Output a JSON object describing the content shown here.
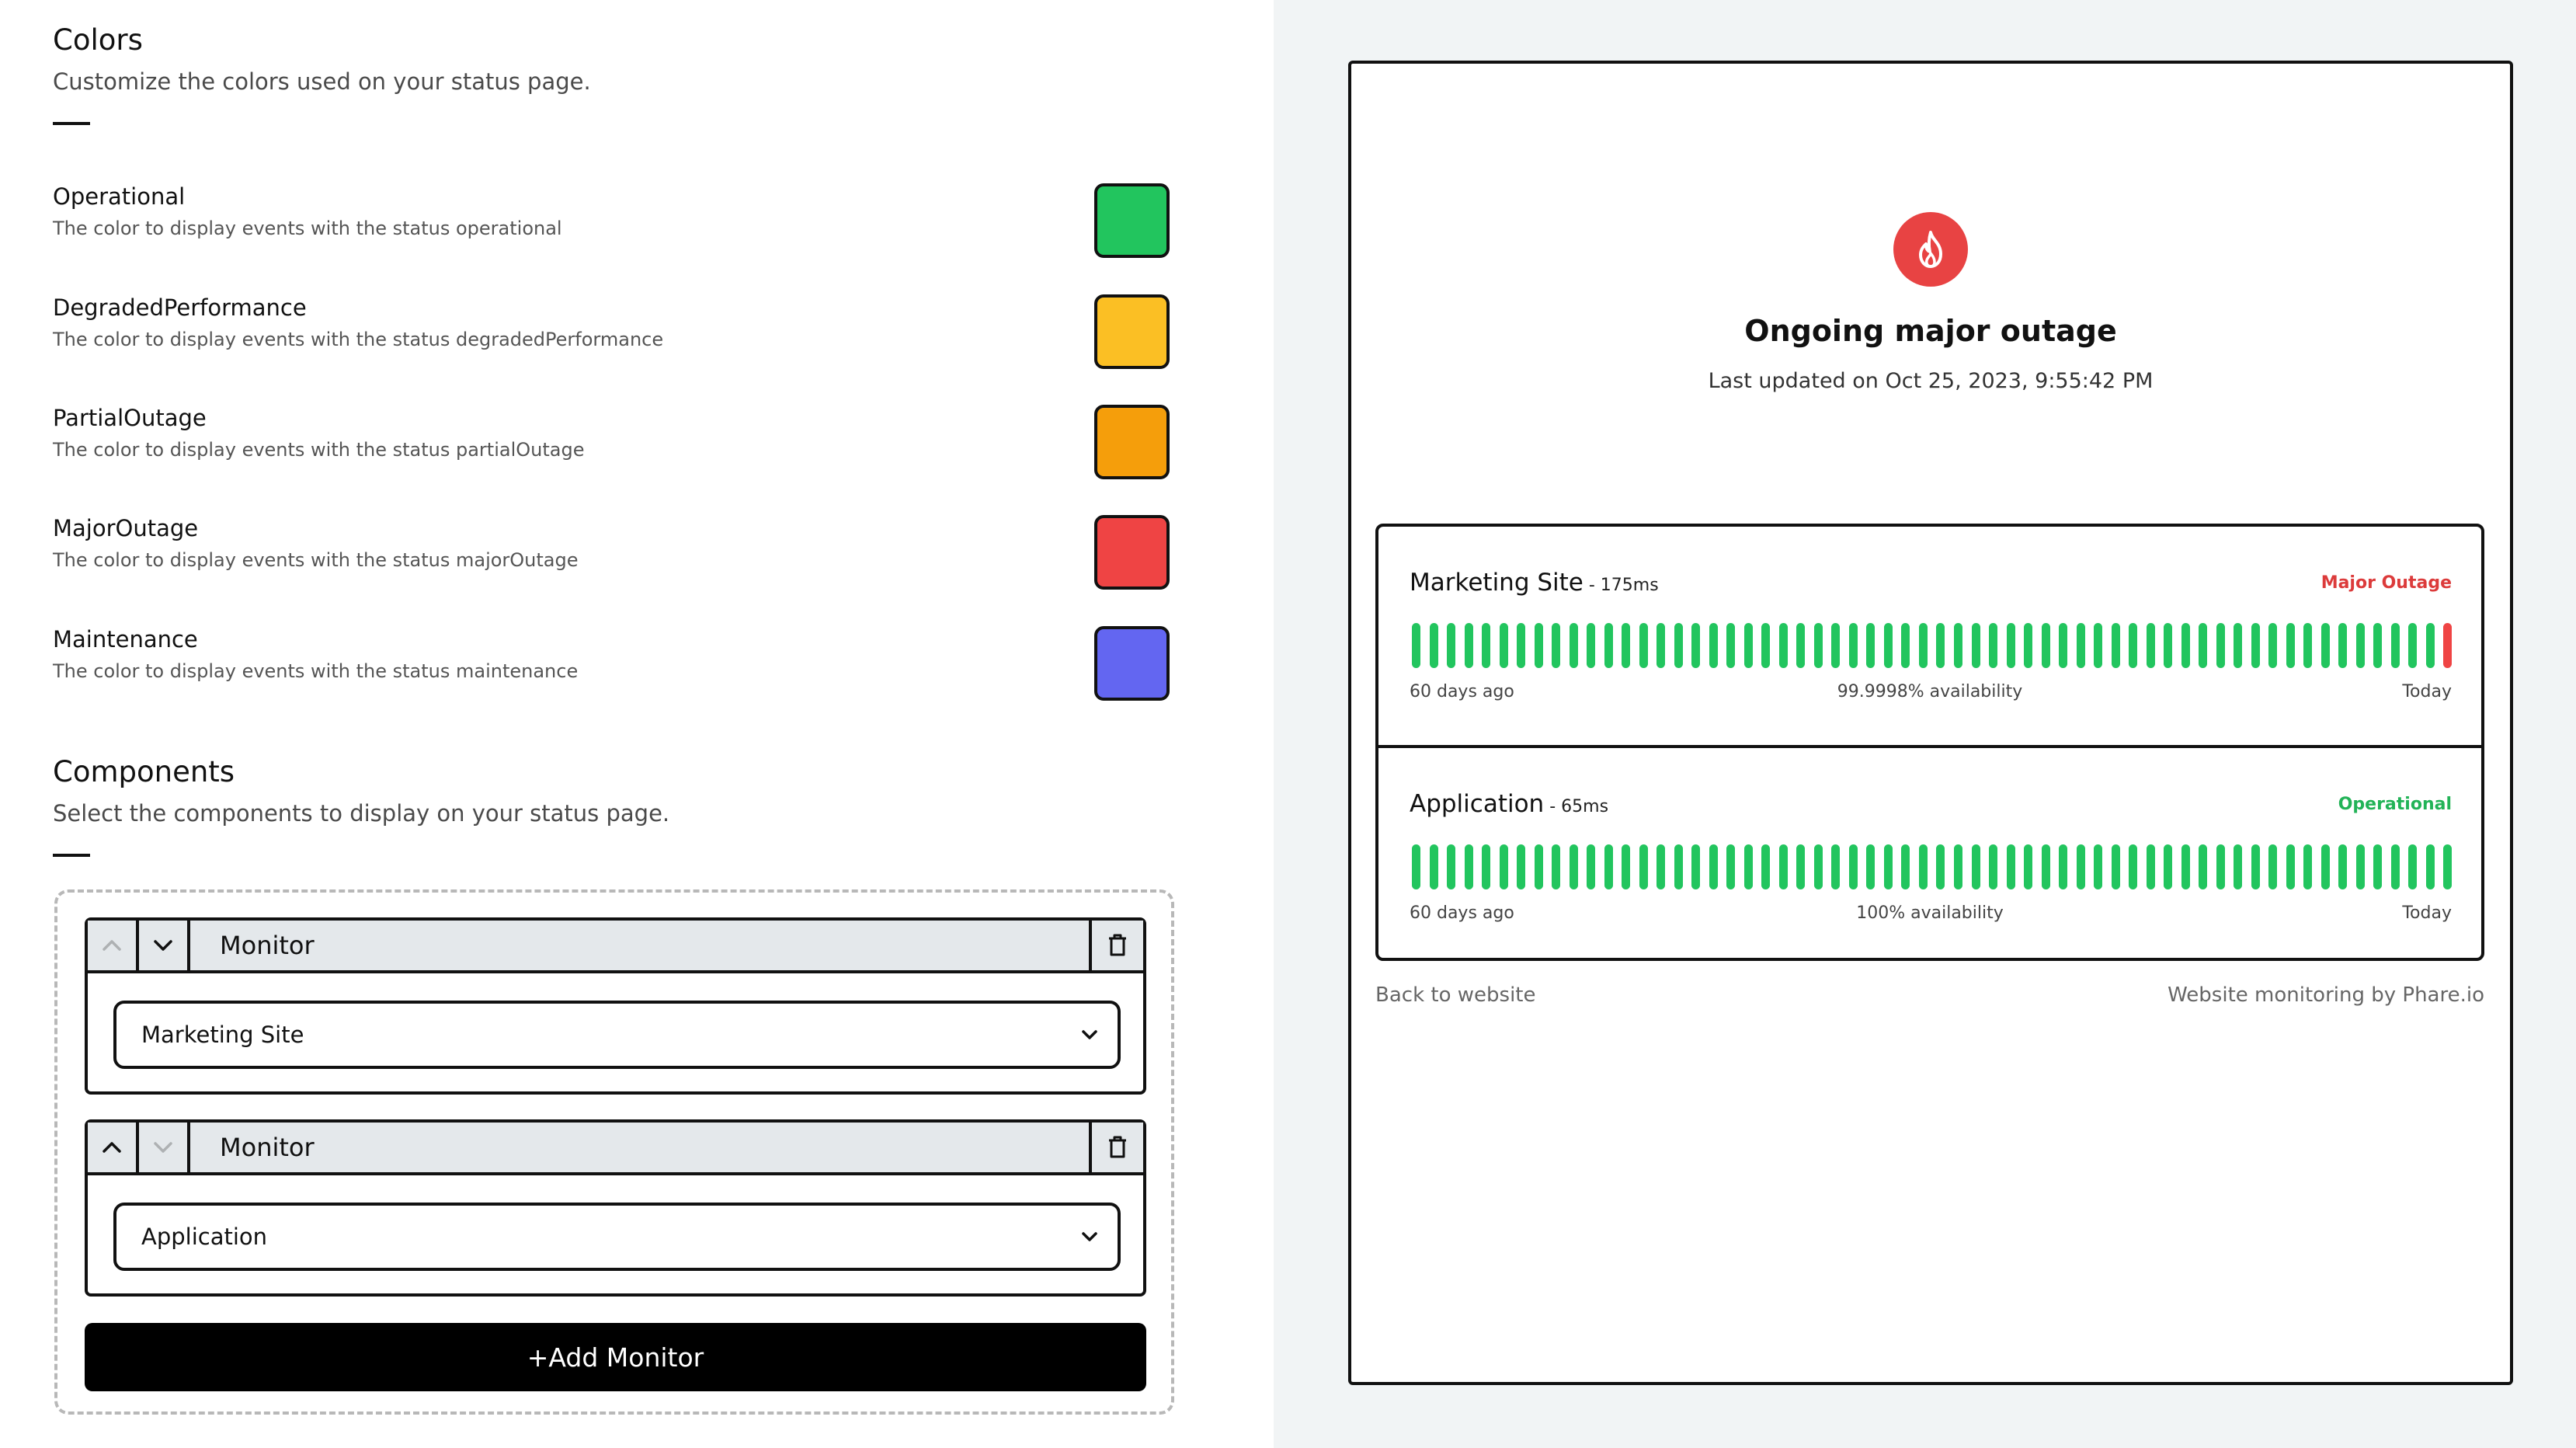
{
  "colors_section": {
    "title": "Colors",
    "subtitle": "Customize the colors used on your status page.",
    "items": [
      {
        "name": "Operational",
        "desc": "The color to display events with the status operational",
        "color": "#22c55e"
      },
      {
        "name": "DegradedPerformance",
        "desc": "The color to display events with the status degradedPerformance",
        "color": "#fbbf24"
      },
      {
        "name": "PartialOutage",
        "desc": "The color to display events with the status partialOutage",
        "color": "#f59e0b"
      },
      {
        "name": "MajorOutage",
        "desc": "The color to display events with the status majorOutage",
        "color": "#ef4444"
      },
      {
        "name": "Maintenance",
        "desc": "The color to display events with the status maintenance",
        "color": "#6366f1"
      }
    ]
  },
  "components_section": {
    "title": "Components",
    "subtitle": "Select the components to display on your status page.",
    "monitors": [
      {
        "header": "Monitor",
        "selected": "Marketing Site",
        "up_disabled": true,
        "down_disabled": false
      },
      {
        "header": "Monitor",
        "selected": "Application",
        "up_disabled": false,
        "down_disabled": true
      }
    ],
    "add_label": "+Add Monitor"
  },
  "preview": {
    "headline": "Ongoing major outage",
    "updated": "Last updated on Oct 25, 2023, 9:55:42 PM",
    "status_items": [
      {
        "name": "Marketing Site",
        "latency": " - 175ms",
        "status": "Major Outage",
        "status_color": "#dc3b3b",
        "start_label": "60 days ago",
        "availability": "99.9998% availability",
        "end_label": "Today",
        "bar_count": 60,
        "last_bar_color": "#ef4444"
      },
      {
        "name": "Application",
        "latency": " - 65ms",
        "status": "Operational",
        "status_color": "#22b357",
        "start_label": "60 days ago",
        "availability": "100% availability",
        "end_label": "Today",
        "bar_count": 60,
        "last_bar_color": "#22c55e"
      }
    ],
    "back_link": "Back to website",
    "powered_by": "Website monitoring by Phare.io"
  }
}
